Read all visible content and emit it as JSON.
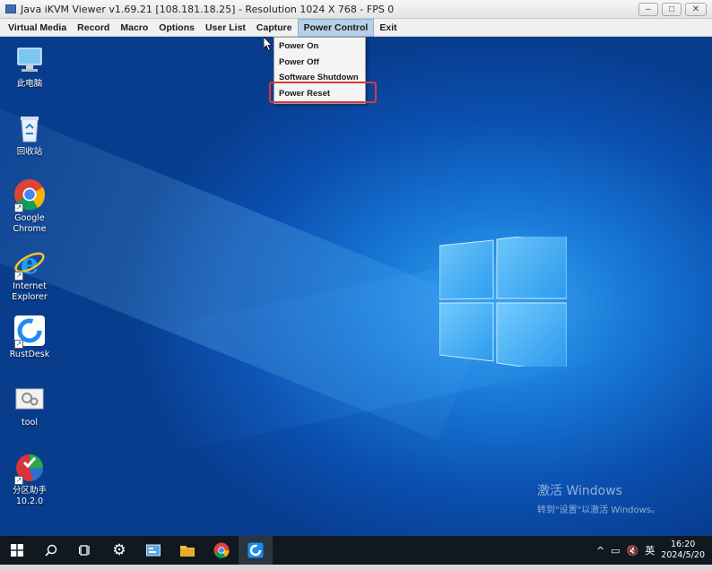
{
  "window": {
    "title": "Java iKVM Viewer v1.69.21 [108.181.18.25]  - Resolution 1024 X 768 - FPS 0",
    "buttons": {
      "minimize": "–",
      "maximize": "□",
      "close": "✕"
    }
  },
  "menubar": {
    "items": [
      "Virtual Media",
      "Record",
      "Macro",
      "Options",
      "User List",
      "Capture",
      "Power Control",
      "Exit"
    ],
    "active": "Power Control"
  },
  "power_menu": {
    "items": [
      "Power On",
      "Power Off",
      "Software Shutdown",
      "Power Reset"
    ],
    "highlighted": "Power Reset"
  },
  "desktop": {
    "icons": [
      {
        "label": "此电脑",
        "icon": "computer-icon"
      },
      {
        "label": "回收站",
        "icon": "recycle-bin-icon"
      },
      {
        "label": "Google Chrome",
        "icon": "chrome-icon"
      },
      {
        "label": "Internet Explorer",
        "icon": "ie-icon"
      },
      {
        "label": "RustDesk",
        "icon": "rustdesk-icon"
      },
      {
        "label": "tool",
        "icon": "tool-folder-icon"
      },
      {
        "label": "分区助手 10.2.0",
        "icon": "partition-assistant-icon"
      }
    ],
    "activation": {
      "line1": "激活 Windows",
      "line2": "转到\"设置\"以激活 Windows。"
    }
  },
  "taskbar": {
    "tray_lang": "英",
    "time": "16:20",
    "date": "2024/5/20"
  },
  "colors": {
    "highlight": "#d83a3a",
    "menu_active": "#b8cfe8"
  }
}
